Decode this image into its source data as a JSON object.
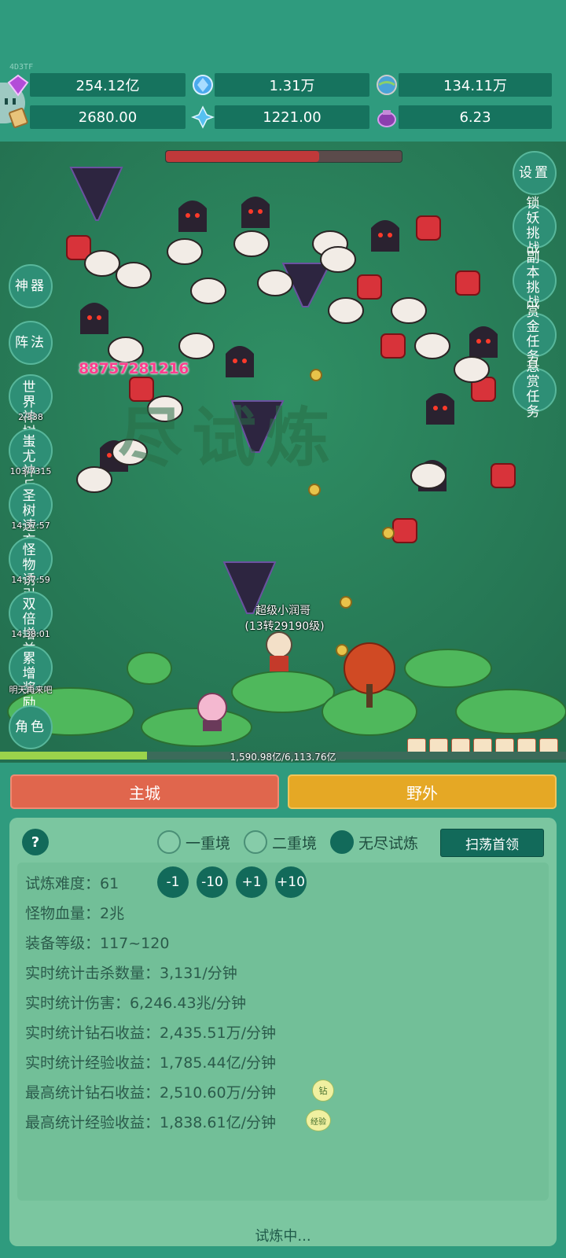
{
  "debug_tag": "4D3TF",
  "resources": {
    "row1": [
      {
        "icon": "purple-gem-icon",
        "value": "254.12亿",
        "color": "#b34cd8"
      },
      {
        "icon": "blue-crystal-icon",
        "value": "1.31万",
        "color": "#4aa9ee"
      },
      {
        "icon": "globe-orb-icon",
        "value": "134.11万",
        "color": "#4aa3d8"
      }
    ],
    "row2": [
      {
        "icon": "scroll-icon",
        "value": "2680.00",
        "color": "#d9a05a"
      },
      {
        "icon": "ice-crystal-icon",
        "value": "1221.00",
        "color": "#56c0f0"
      },
      {
        "icon": "potion-bag-icon",
        "value": "6.23",
        "color": "#8b3fae"
      }
    ]
  },
  "boss_hp": {
    "fraction": 0.65
  },
  "left_buttons": [
    {
      "label": "神器",
      "sub": ""
    },
    {
      "label": "阵法",
      "sub": ""
    },
    {
      "label": "世界神树",
      "sub": "2/338"
    },
    {
      "label": "蚩尤神兵",
      "sub": "103/7315"
    },
    {
      "label": "圣树速充",
      "sub": "14:37:57"
    },
    {
      "label": "怪物诱引",
      "sub": "14:37:59"
    },
    {
      "label": "双倍增益",
      "sub": "14:38:01"
    },
    {
      "label": "累增奖励",
      "sub": "明天再来吧"
    },
    {
      "label": "角色",
      "sub": ""
    }
  ],
  "right_buttons": [
    "设置",
    "锁妖挑战",
    "副本挑战",
    "赏金任务",
    "悬赏任务"
  ],
  "battle": {
    "damage_text": "88757281216",
    "watermark": "尽试炼",
    "player_name": "超级小润哥",
    "player_level": "(13转29190级)"
  },
  "exp": {
    "text": "1,590.98亿/6,113.76亿",
    "fraction": 0.26
  },
  "nav": {
    "city": "主城",
    "wild": "野外"
  },
  "trial": {
    "help": "?",
    "modes": [
      {
        "label": "一重境",
        "on": false
      },
      {
        "label": "二重境",
        "on": false
      },
      {
        "label": "无尽试炼",
        "on": true
      }
    ],
    "sweep": "扫荡首领",
    "steps": [
      "-1",
      "-10",
      "+1",
      "+10"
    ],
    "stats": [
      "试炼难度：61",
      "怪物血量：2兆",
      "装备等级：117~120",
      "实时统计击杀数量：3,131/分钟",
      "实时统计伤害：6,246.43兆/分钟",
      "实时统计钻石收益：2,435.51万/分钟",
      "实时统计经验收益：1,785.44亿/分钟",
      "最高统计钻石收益：2,510.60万/分钟",
      "最高统计经验收益：1,838.61亿/分钟"
    ],
    "badge_diamond": "钻",
    "badge_exp": "经验",
    "status": "试炼中..."
  }
}
